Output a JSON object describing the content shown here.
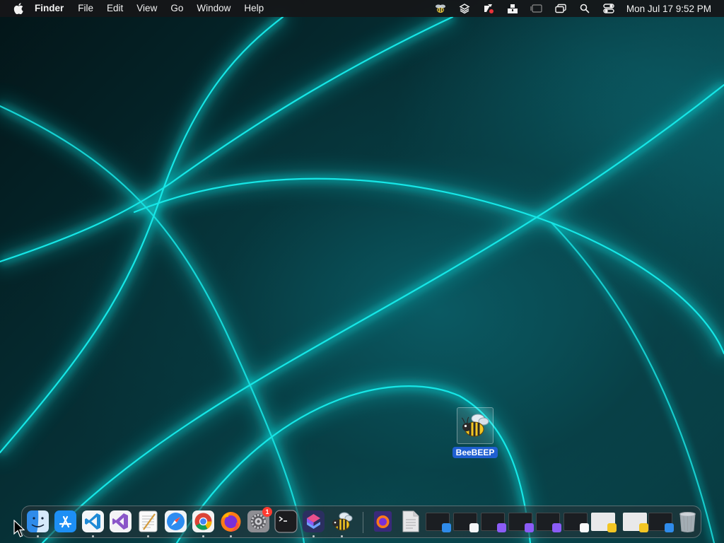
{
  "menubar": {
    "app_name": "Finder",
    "menus": [
      "File",
      "Edit",
      "View",
      "Go",
      "Window",
      "Help"
    ],
    "status_icons": [
      "beebeep-icon",
      "layers-icon",
      "tool-icon",
      "dropbox-icon",
      "screen-mirroring-icon",
      "window-icon",
      "search-icon",
      "control-center-icon"
    ],
    "clock": "Mon Jul 17  9:52 PM"
  },
  "desktop": {
    "icons": [
      {
        "label": "BeeBEEP",
        "icon": "bee-icon",
        "selected": true
      }
    ]
  },
  "dock": {
    "apps": [
      {
        "name": "Finder",
        "icon": "finder-icon",
        "running": true
      },
      {
        "name": "App Store",
        "icon": "app-store-icon",
        "running": false
      },
      {
        "name": "Visual Studio Code",
        "icon": "vscode-icon",
        "running": true
      },
      {
        "name": "Visual Studio",
        "icon": "visual-studio-icon",
        "running": false
      },
      {
        "name": "TextEdit",
        "icon": "textedit-icon",
        "running": true
      },
      {
        "name": "Safari",
        "icon": "safari-icon",
        "running": false
      },
      {
        "name": "Google Chrome",
        "icon": "chrome-icon",
        "running": true
      },
      {
        "name": "Firefox",
        "icon": "firefox-icon",
        "running": true
      },
      {
        "name": "System Settings",
        "icon": "settings-icon",
        "running": false,
        "badge": "1"
      },
      {
        "name": "Terminal",
        "icon": "terminal-icon",
        "running": false
      },
      {
        "name": "Shortcuts",
        "icon": "shortcuts-icon",
        "running": true
      },
      {
        "name": "BeeBEEP",
        "icon": "bee-icon",
        "running": true
      }
    ],
    "right": [
      {
        "icon": "firefox-folder-icon",
        "kind": "folder"
      },
      {
        "icon": "document-icon",
        "kind": "document"
      },
      {
        "icon": "window-thumbnail-finder",
        "kind": "window"
      },
      {
        "icon": "window-thumbnail-vscode",
        "kind": "window"
      },
      {
        "icon": "window-thumbnail-shortcuts",
        "kind": "window"
      },
      {
        "icon": "window-thumbnail-shortcuts-2",
        "kind": "window"
      },
      {
        "icon": "window-thumbnail-shortcuts-3",
        "kind": "window"
      },
      {
        "icon": "window-thumbnail-textedit",
        "kind": "window"
      },
      {
        "icon": "window-thumbnail-beebeep",
        "kind": "window"
      },
      {
        "icon": "window-thumbnail-beebeep-2",
        "kind": "window"
      },
      {
        "icon": "window-thumbnail-finder-2",
        "kind": "window"
      },
      {
        "icon": "trash-icon",
        "kind": "trash"
      }
    ]
  },
  "colors": {
    "accent_selection": "#1f5fd1",
    "wallpaper_glow": "#19e6e6",
    "badge_red": "#ff3b30"
  }
}
